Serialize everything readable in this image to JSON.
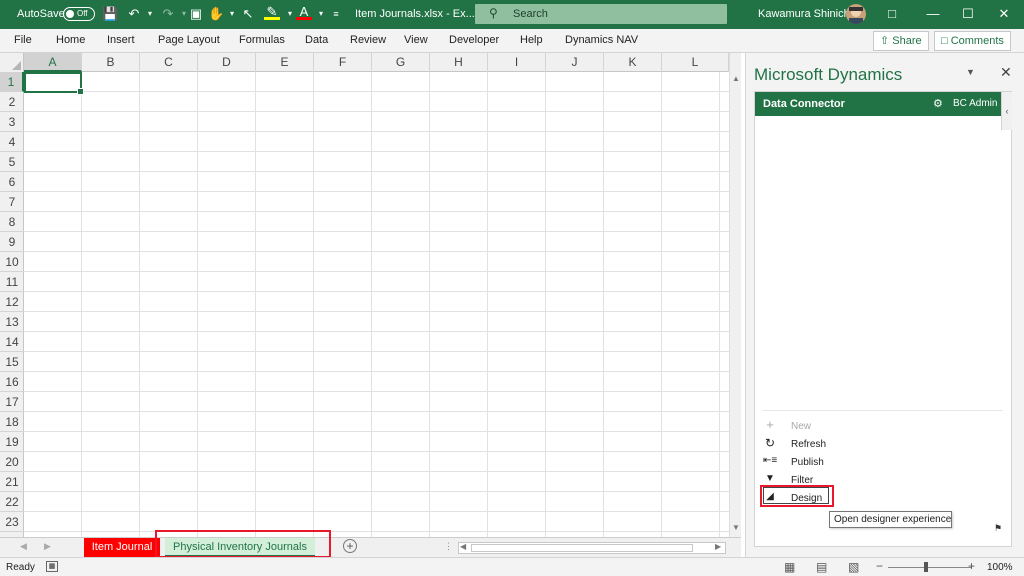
{
  "titlebar": {
    "autosave_label": "AutoSave",
    "autosave_state": "Off",
    "filename": "Item Journals.xlsx  -  Ex...",
    "search_placeholder": "Search",
    "user_name": "Kawamura Shinichi"
  },
  "ribbon": {
    "tabs": [
      "File",
      "Home",
      "Insert",
      "Page Layout",
      "Formulas",
      "Data",
      "Review",
      "View",
      "Developer",
      "Help",
      "Dynamics NAV"
    ],
    "share_label": "Share",
    "comments_label": "Comments"
  },
  "grid": {
    "columns": [
      "A",
      "B",
      "C",
      "D",
      "E",
      "F",
      "G",
      "H",
      "I",
      "J",
      "K",
      "L"
    ],
    "rows": [
      "1",
      "2",
      "3",
      "4",
      "5",
      "6",
      "7",
      "8",
      "9",
      "10",
      "11",
      "12",
      "13",
      "14",
      "15",
      "16",
      "17",
      "18",
      "19",
      "20",
      "21",
      "22",
      "23"
    ],
    "active_cell": "A1"
  },
  "sheets": {
    "tabs": [
      "Item Journal",
      "Physical Inventory Journals"
    ],
    "active": "Physical Inventory Journals",
    "colors": {
      "item_journal_bg": "#ff0000",
      "item_journal_text": "#ffffff",
      "active_bg": "#d4efd9",
      "active_text": "#217346"
    }
  },
  "status": {
    "ready_label": "Ready",
    "zoom": "100%"
  },
  "pane": {
    "title": "Microsoft Dynamics",
    "connector_label": "Data Connector",
    "admin_label": "BC Admin",
    "actions": [
      {
        "label": "New",
        "icon": "plus-icon",
        "enabled": false
      },
      {
        "label": "Refresh",
        "icon": "refresh-icon",
        "enabled": true
      },
      {
        "label": "Publish",
        "icon": "publish-icon",
        "enabled": true
      },
      {
        "label": "Filter",
        "icon": "filter-icon",
        "enabled": true
      },
      {
        "label": "Design",
        "icon": "design-icon",
        "enabled": true
      }
    ],
    "tooltip": "Open designer experience"
  },
  "colors": {
    "brand_green": "#217346",
    "highlight_red": "#e8192c"
  }
}
